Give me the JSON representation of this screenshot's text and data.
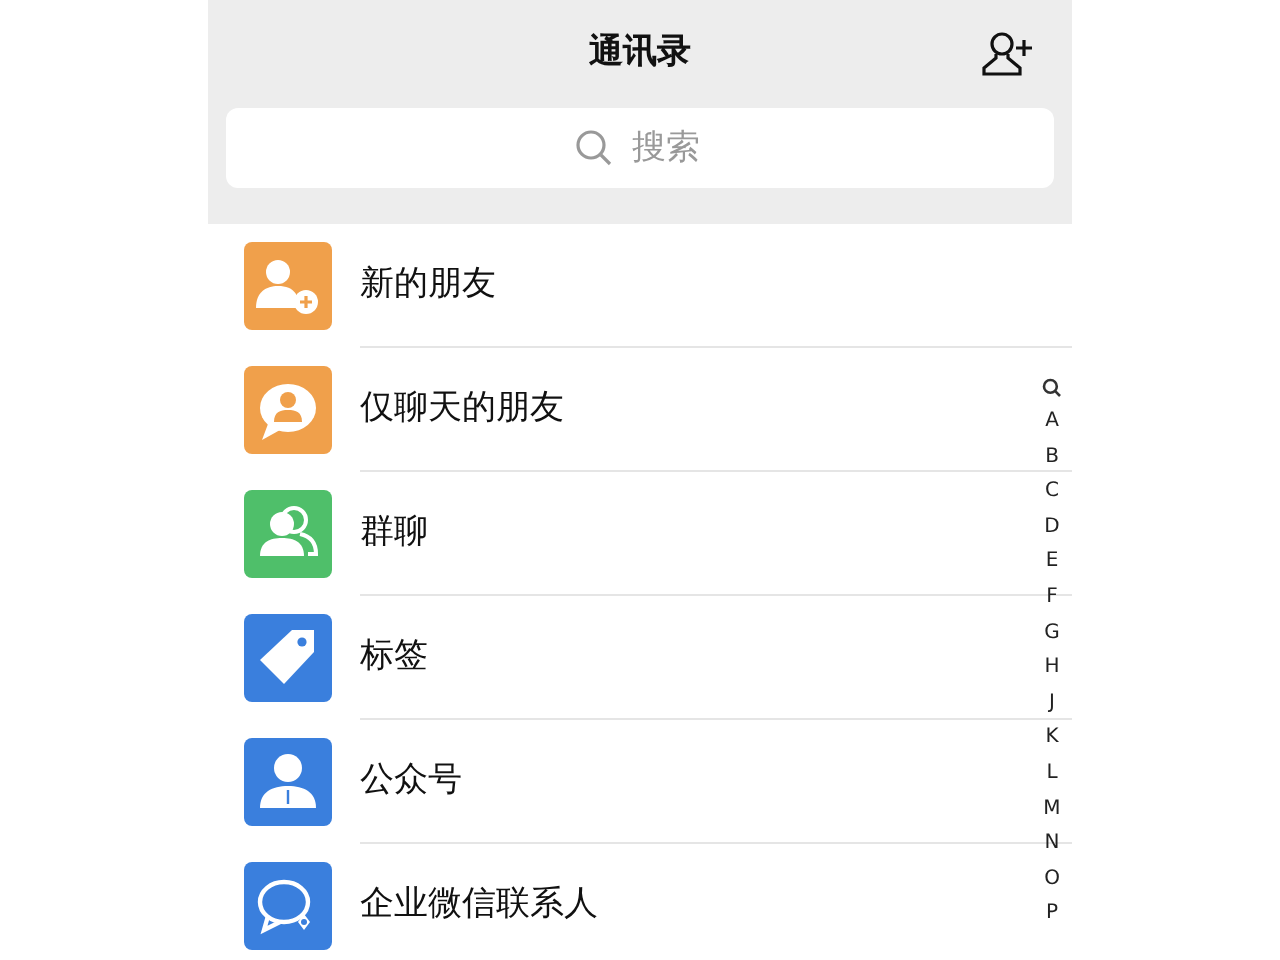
{
  "header": {
    "title": "通讯录"
  },
  "search": {
    "placeholder": "搜索"
  },
  "contacts_list": [
    {
      "label": "新的朋友",
      "kind": "new_friend",
      "color": "#f0a04b"
    },
    {
      "label": "仅聊天的朋友",
      "kind": "chat_only",
      "color": "#f0a04b"
    },
    {
      "label": "群聊",
      "kind": "group",
      "color": "#4fbf6a"
    },
    {
      "label": "标签",
      "kind": "tag",
      "color": "#3a7fdd"
    },
    {
      "label": "公众号",
      "kind": "official",
      "color": "#3a7fdd"
    },
    {
      "label": "企业微信联系人",
      "kind": "enterprise",
      "color": "#3a7fdd"
    }
  ],
  "index_bar": [
    "A",
    "B",
    "C",
    "D",
    "E",
    "F",
    "G",
    "H",
    "J",
    "K",
    "L",
    "M",
    "N",
    "O",
    "P"
  ]
}
